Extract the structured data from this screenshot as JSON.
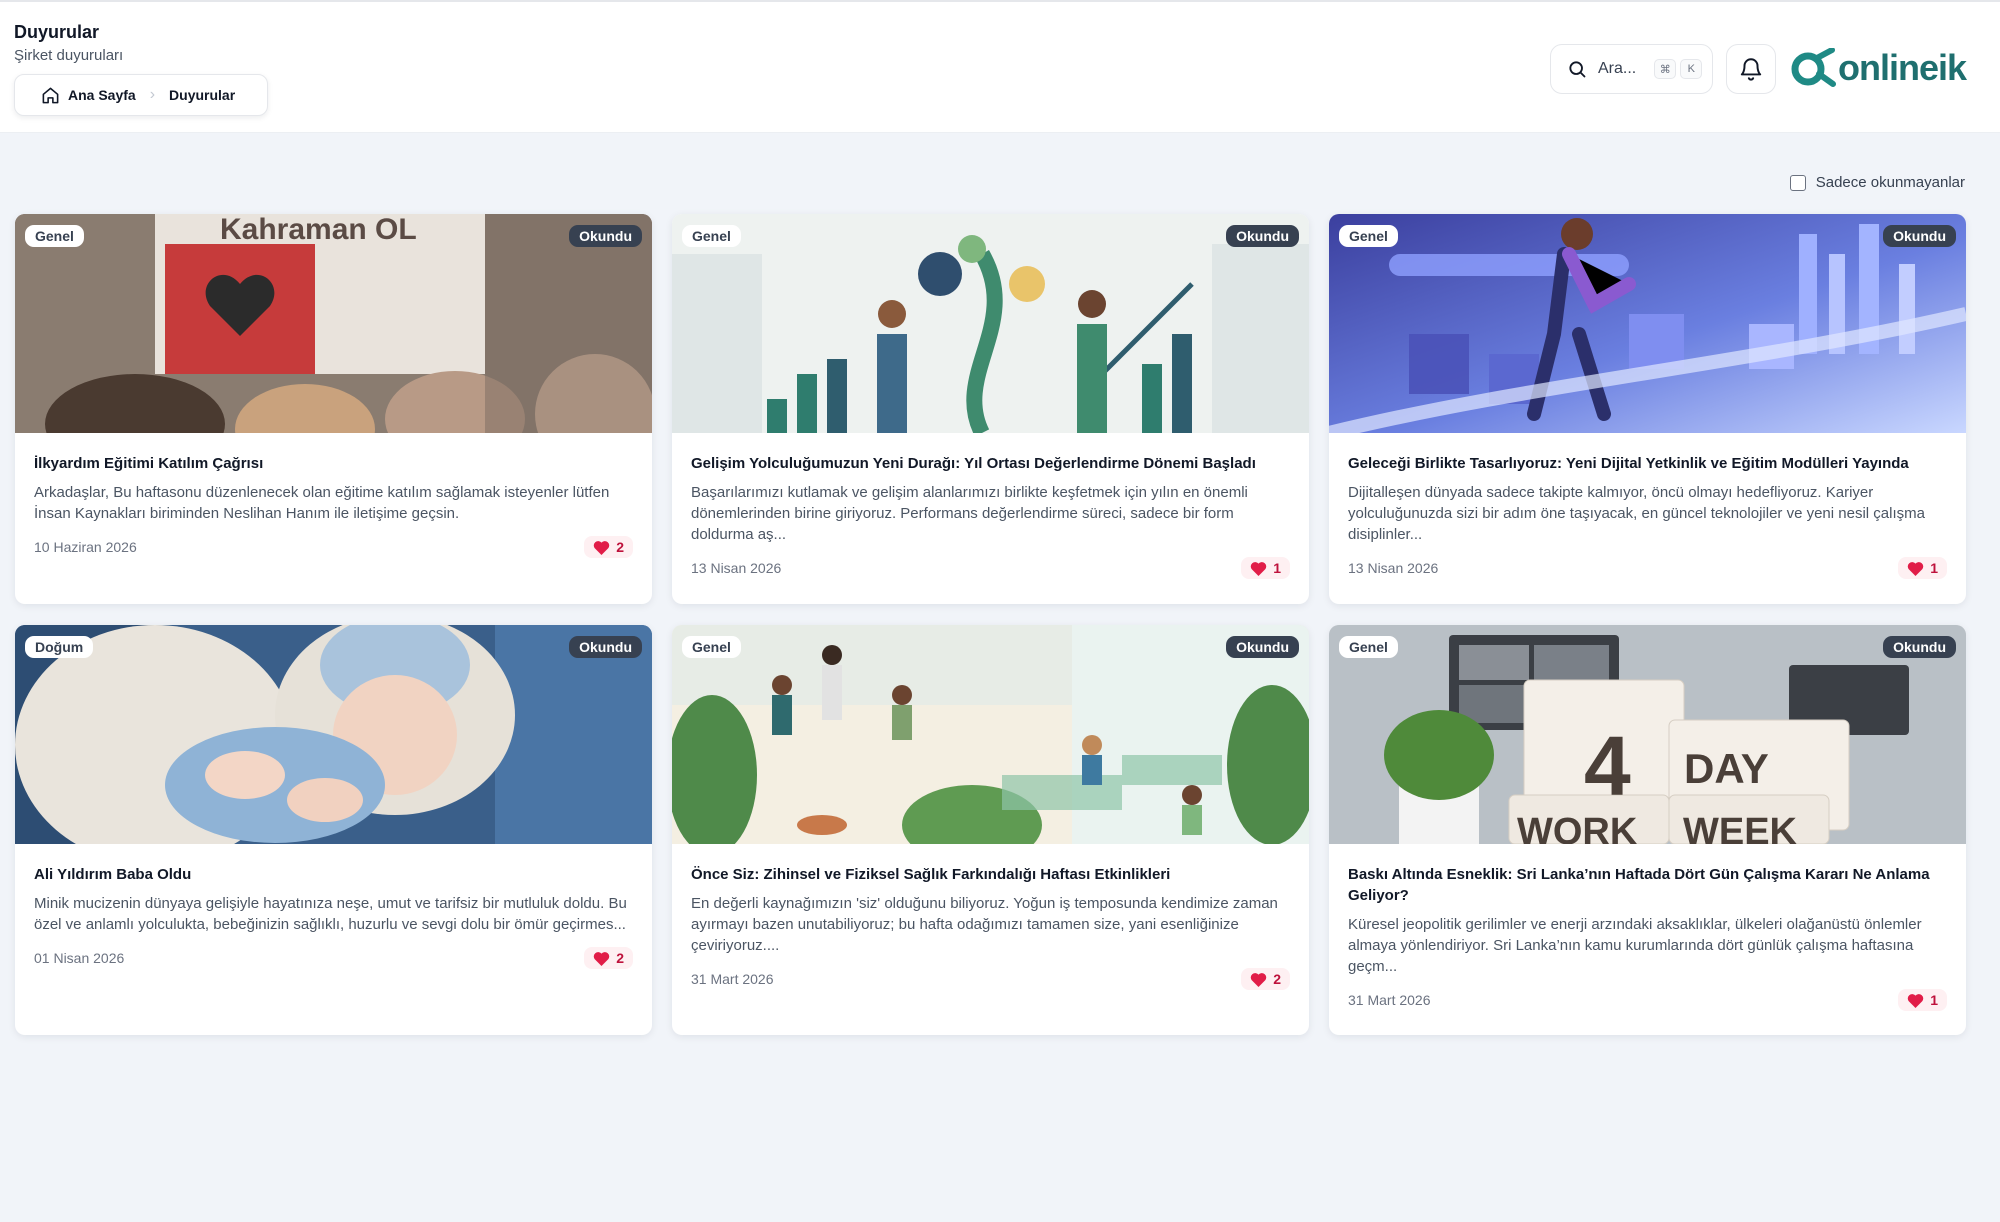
{
  "header": {
    "title": "Duyurular",
    "subtitle": "Şirket duyuruları",
    "breadcrumb": {
      "home": "Ana Sayfa",
      "current": "Duyurular"
    },
    "search": {
      "placeholder": "Ara...",
      "shortcut_mod": "⌘",
      "shortcut_key": "K"
    },
    "logo": "onlineik"
  },
  "filter": {
    "label": "Sadece okunmayanlar",
    "checked": false
  },
  "colors": {
    "accent": "#1f6f6f",
    "heart": "#e11d48",
    "read_badge": "#374151"
  },
  "cards": [
    {
      "category": "Genel",
      "status": "Okundu",
      "title": "İlkyardım Eğitimi Katılım Çağrısı",
      "excerpt": "Arkadaşlar, Bu haftasonu düzenlenecek olan eğitime katılım sağlamak isteyenler lütfen İnsan Kaynakları biriminden Neslihan Hanım ile iletişime geçsin.",
      "date": "10 Haziran 2026",
      "likes": "2",
      "image_text": "Kahraman OL"
    },
    {
      "category": "Genel",
      "status": "Okundu",
      "title": "Gelişim Yolculuğumuzun Yeni Durağı: Yıl Ortası Değerlendirme Dönemi Başladı",
      "excerpt": "Başarılarımızı kutlamak ve gelişim alanlarımızı birlikte keşfetmek için yılın en önemli dönemlerinden birine giriyoruz. Performans değerlendirme süreci, sadece bir form doldurma aş...",
      "date": "13 Nisan 2026",
      "likes": "1"
    },
    {
      "category": "Genel",
      "status": "Okundu",
      "title": "Geleceği Birlikte Tasarlıyoruz: Yeni Dijital Yetkinlik ve Eğitim Modülleri Yayında",
      "excerpt": "Dijitalleşen dünyada sadece takipte kalmıyor, öncü olmayı hedefliyoruz. Kariyer yolculuğunuzda sizi bir adım öne taşıyacak, en güncel teknolojiler ve yeni nesil çalışma disiplinler...",
      "date": "13 Nisan 2026",
      "likes": "1"
    },
    {
      "category": "Doğum",
      "status": "Okundu",
      "title": "Ali Yıldırım Baba Oldu",
      "excerpt": "Minik mucizenin dünyaya gelişiyle hayatınıza neşe, umut ve tarifsiz bir mutluluk doldu. Bu özel ve anlamlı yolculukta, bebeğinizin sağlıklı, huzurlu ve sevgi dolu bir ömür geçirmes...",
      "date": "01 Nisan 2026",
      "likes": "2"
    },
    {
      "category": "Genel",
      "status": "Okundu",
      "title": "Önce Siz: Zihinsel ve Fiziksel Sağlık Farkındalığı Haftası Etkinlikleri",
      "excerpt": "En değerli kaynağımızın 'siz' olduğunu biliyoruz. Yoğun iş temposunda kendimize zaman ayırmayı bazen unutabiliyoruz; bu hafta odağımızı tamamen size, yani esenliğinize çeviriyoruz....",
      "date": "31 Mart 2026",
      "likes": "2"
    },
    {
      "category": "Genel",
      "status": "Okundu",
      "title": "Baskı Altında Esneklik: Sri Lanka’nın Haftada Dört Gün Çalışma Kararı Ne Anlama Geliyor?",
      "excerpt": "Küresel jeopolitik gerilimler ve enerji arzındaki aksaklıklar, ülkeleri olağanüstü önlemler almaya yönlendiriyor. Sri Lanka’nın kamu kurumlarında dört günlük çalışma haftasına geçm...",
      "date": "31 Mart 2026",
      "likes": "1",
      "image_text_1": "4",
      "image_text_2": "DAY",
      "image_text_3": "WORK",
      "image_text_4": "WEEK"
    }
  ]
}
